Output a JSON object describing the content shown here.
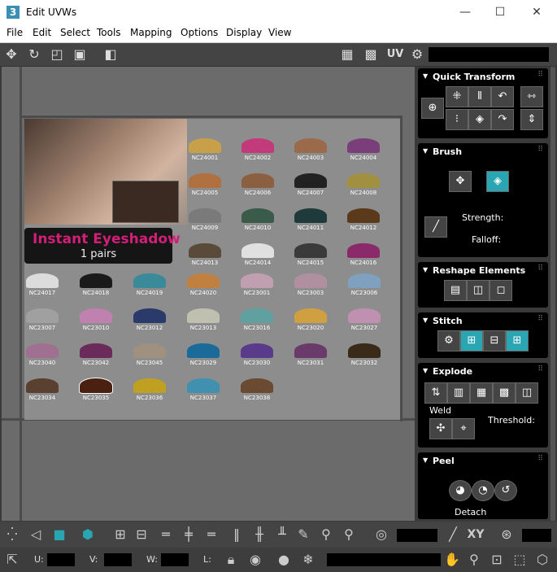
{
  "window": {
    "title": "Edit UVWs",
    "app_badge": "3",
    "minimize": "—",
    "maximize": "☐",
    "close": "✕"
  },
  "menu": [
    "File",
    "Edit",
    "Select",
    "Tools",
    "Mapping",
    "Options",
    "Display",
    "View"
  ],
  "toolbar": {
    "uv_label": "UV"
  },
  "texture": {
    "banner_title": "Instant Eyeshadow",
    "banner_sub": "1 pairs",
    "swatches": [
      {
        "label": "NC24001",
        "color": "#c8a04a"
      },
      {
        "label": "NC24002",
        "color": "#c23a7a"
      },
      {
        "label": "NC24003",
        "color": "#9a6a4a"
      },
      {
        "label": "NC24004",
        "color": "#7a3f7a"
      },
      {
        "label": "NC24005",
        "color": "#b07040"
      },
      {
        "label": "NC24006",
        "color": "#8a6040"
      },
      {
        "label": "NC24007",
        "color": "#222222"
      },
      {
        "label": "NC24008",
        "color": "#a09040"
      },
      {
        "label": "NC24009",
        "color": "#7a7a7a"
      },
      {
        "label": "NC24010",
        "color": "#3a5a4a"
      },
      {
        "label": "NC24011",
        "color": "#1f3a3a"
      },
      {
        "label": "NC24012",
        "color": "#5a3a1a"
      },
      {
        "label": "NC24013",
        "color": "#5a4a3a"
      },
      {
        "label": "NC24014",
        "color": "#e0e0e0"
      },
      {
        "label": "NC24015",
        "color": "#3a3a3a"
      },
      {
        "label": "NC24016",
        "color": "#8a2a6a"
      },
      {
        "label": "NC24017",
        "color": "#dcdcdc"
      },
      {
        "label": "NC24018",
        "color": "#1a1a1a"
      },
      {
        "label": "NC24019",
        "color": "#3a8a9a"
      },
      {
        "label": "NC24020",
        "color": "#c08040"
      },
      {
        "label": "NC23001",
        "color": "#c0a0b0"
      },
      {
        "label": "NC23003",
        "color": "#b090a0"
      },
      {
        "label": "NC23006",
        "color": "#80a0c0"
      },
      {
        "label": "NC23007",
        "color": "#a0a0a0"
      },
      {
        "label": "NC23010",
        "color": "#c080b0"
      },
      {
        "label": "NC23012",
        "color": "#2a3a6a"
      },
      {
        "label": "NC23013",
        "color": "#c0c0b0"
      },
      {
        "label": "NC23016",
        "color": "#60a0a0"
      },
      {
        "label": "NC23020",
        "color": "#d0a040"
      },
      {
        "label": "NC23027",
        "color": "#c090b0"
      },
      {
        "label": "NC23040",
        "color": "#a07090"
      },
      {
        "label": "NC23042",
        "color": "#6a2a5a"
      },
      {
        "label": "NC23045",
        "color": "#a09080"
      },
      {
        "label": "NC23029",
        "color": "#1a6a9a"
      },
      {
        "label": "NC23030",
        "color": "#5a3a8a"
      },
      {
        "label": "NC23031",
        "color": "#6a3a6a"
      },
      {
        "label": "NC23032",
        "color": "#3a2a1a"
      },
      {
        "label": "NC23034",
        "color": "#5a4030"
      },
      {
        "label": "NC23035",
        "color": "#4a2010"
      },
      {
        "label": "NC23036",
        "color": "#c0a020"
      },
      {
        "label": "NC23037",
        "color": "#4090b0"
      },
      {
        "label": "NC23038",
        "color": "#6a4a30"
      }
    ]
  },
  "rollouts": {
    "quick_transform": "Quick Transform",
    "brush": "Brush",
    "strength": "Strength:",
    "falloff": "Falloff:",
    "reshape": "Reshape Elements",
    "stitch": "Stitch",
    "explode": "Explode",
    "weld": "Weld",
    "threshold": "Threshold:",
    "peel": "Peel",
    "detach": "Detach"
  },
  "bottom": {
    "xy": "XY",
    "u": "U:",
    "v": "V:",
    "w": "W:",
    "l": "L:"
  }
}
